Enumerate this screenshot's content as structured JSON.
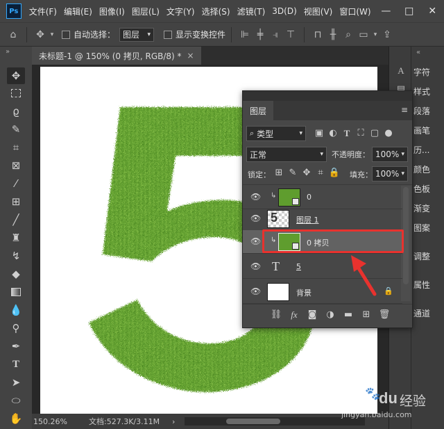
{
  "app": {
    "logo": "Ps"
  },
  "menu": [
    "文件(F)",
    "编辑(E)",
    "图像(I)",
    "图层(L)",
    "文字(Y)",
    "选择(S)",
    "滤镜(T)",
    "3D(D)",
    "视图(V)",
    "窗口(W)"
  ],
  "window_controls": {
    "minimize": "—",
    "maximize": "□",
    "close": "✕"
  },
  "options": {
    "auto_select_label": "自动选择：",
    "auto_select_value": "图层",
    "show_transform_label": "显示变换控件"
  },
  "document": {
    "tab_title": "未标题-1 @ 150% (0 拷贝, RGB/8) *",
    "close": "×",
    "tabs_expand": "»"
  },
  "status": {
    "zoom": "150.26%",
    "doc_info": "文档:527.3K/3.11M",
    "arrow": "›"
  },
  "right_panels": [
    "字符",
    "样式",
    "段落",
    "画笔",
    "历...",
    "颜色",
    "色板",
    "渐变",
    "图案",
    "调整",
    "属性",
    "通道"
  ],
  "layers_panel": {
    "title": "图层",
    "filter_label": "类型",
    "blend_mode": "正常",
    "opacity_label": "不透明度：",
    "opacity_value": "100%",
    "lock_label": "锁定：",
    "fill_label": "填充：",
    "fill_value": "100%",
    "layers": [
      {
        "name": "0",
        "type": "clipped-image",
        "visible": true,
        "selected": false
      },
      {
        "name": "图层 1",
        "type": "raster",
        "visible": true,
        "selected": false
      },
      {
        "name": "0 拷贝",
        "type": "clipped-image",
        "visible": true,
        "selected": true
      },
      {
        "name": "5",
        "type": "text",
        "visible": true,
        "selected": false
      },
      {
        "name": "背景",
        "type": "background",
        "visible": true,
        "selected": false,
        "locked": true
      }
    ]
  },
  "canvas": {
    "digit": "5",
    "grass_color": "#5f9d2e",
    "highlight_color": "#e8322e"
  },
  "watermark": {
    "brand": "Bai",
    "brand2": "du",
    "site": "经验",
    "url": "jingyan.baidu.com"
  }
}
